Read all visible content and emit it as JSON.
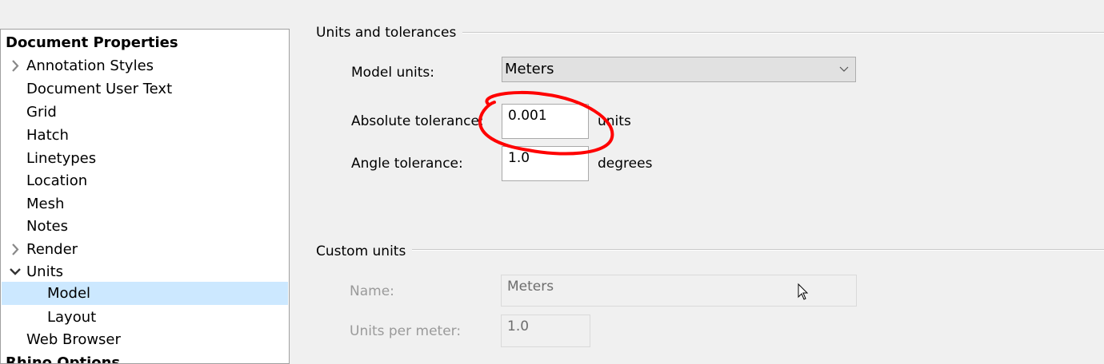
{
  "tree": {
    "header": "Document Properties",
    "items": [
      {
        "label": "Annotation Styles",
        "expander": "collapsed"
      },
      {
        "label": "Document User Text"
      },
      {
        "label": "Grid"
      },
      {
        "label": "Hatch"
      },
      {
        "label": "Linetypes"
      },
      {
        "label": "Location"
      },
      {
        "label": "Mesh"
      },
      {
        "label": "Notes"
      },
      {
        "label": "Render",
        "expander": "collapsed"
      },
      {
        "label": "Units",
        "expander": "expanded"
      },
      {
        "label": "Model",
        "selected": true
      },
      {
        "label": "Layout"
      },
      {
        "label": "Web Browser"
      }
    ],
    "next_header": "Rhino Options"
  },
  "units_group": {
    "title": "Units and tolerances",
    "model_units_label": "Model units:",
    "model_units_value": "Meters",
    "abs_tol_label": "Absolute tolerance:",
    "abs_tol_value": "0.001",
    "abs_tol_suffix": "units",
    "angle_tol_label": "Angle tolerance:",
    "angle_tol_value": "1.0",
    "angle_tol_suffix": "degrees"
  },
  "custom_group": {
    "title": "Custom units",
    "name_label": "Name:",
    "name_value": "Meters",
    "upm_label": "Units per meter:",
    "upm_value": "1.0"
  },
  "colors": {
    "selection": "#cce8ff",
    "annotation": "#ff0000"
  }
}
